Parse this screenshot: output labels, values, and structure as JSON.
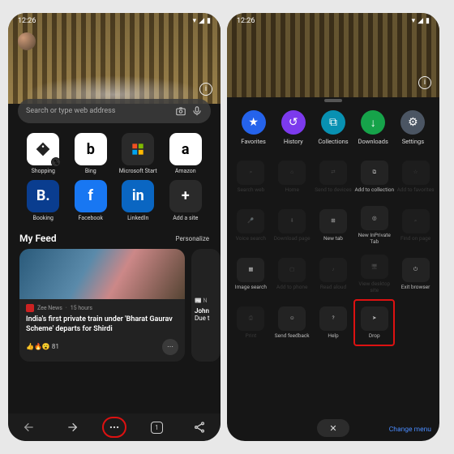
{
  "left": {
    "status": {
      "time": "12:26"
    },
    "search": {
      "placeholder": "Search or type web address"
    },
    "tiles": [
      {
        "label": "Shopping",
        "box": "white",
        "dot": true,
        "icon": "tag-icon"
      },
      {
        "label": "Bing",
        "box": "white",
        "text": "b"
      },
      {
        "label": "Microsoft Start",
        "box": "dark",
        "icon": "msstart-icon"
      },
      {
        "label": "Amazon",
        "box": "white",
        "text": "a"
      },
      {
        "label": "Booking",
        "box": "blue",
        "text": "B."
      },
      {
        "label": "Facebook",
        "box": "fb",
        "text": "f"
      },
      {
        "label": "LinkedIn",
        "box": "li",
        "text": "in"
      },
      {
        "label": "Add a site",
        "box": "dark",
        "text": "+"
      }
    ],
    "feed": {
      "title": "My Feed",
      "personalize": "Personalize",
      "card1": {
        "source": "Zee News",
        "age": "15 hours",
        "title": "India's first private train under 'Bharat Gaurav Scheme' departs for Shirdi",
        "reactions": "👍🔥😮 81"
      },
      "card2": {
        "source": "N",
        "title": "John",
        "subtitle": "Due t"
      }
    },
    "bottom": {
      "tab_count": "1"
    }
  },
  "right": {
    "status": {
      "time": "12:26"
    },
    "quick": [
      {
        "label": "Favorites",
        "cls": "q-blue",
        "icon": "star-icon"
      },
      {
        "label": "History",
        "cls": "q-purple",
        "icon": "history-icon"
      },
      {
        "label": "Collections",
        "cls": "q-teal",
        "icon": "collections-icon"
      },
      {
        "label": "Downloads",
        "cls": "q-green",
        "icon": "download-icon"
      },
      {
        "label": "Settings",
        "cls": "q-gray",
        "icon": "gear-icon"
      }
    ],
    "grid": [
      {
        "label": "Search web",
        "icon": "search-icon"
      },
      {
        "label": "Home",
        "icon": "home-icon"
      },
      {
        "label": "Send to devices",
        "icon": "devices-icon"
      },
      {
        "label": "Add to collection",
        "icon": "collections-add-icon",
        "enabled": true
      },
      {
        "label": "Add to favorites",
        "icon": "star-add-icon"
      },
      {
        "label": "Voice search",
        "icon": "mic-icon"
      },
      {
        "label": "Download page",
        "icon": "download-icon"
      },
      {
        "label": "New tab",
        "icon": "newtab-icon",
        "enabled": true
      },
      {
        "label": "New InPrivate Tab",
        "icon": "inprivate-icon",
        "enabled": true
      },
      {
        "label": "Find on page",
        "icon": "find-icon"
      },
      {
        "label": "Image search",
        "icon": "image-icon",
        "enabled": true
      },
      {
        "label": "Add to phone",
        "icon": "addphone-icon"
      },
      {
        "label": "Read aloud",
        "icon": "readaloud-icon"
      },
      {
        "label": "View desktop site",
        "icon": "desktop-icon"
      },
      {
        "label": "Exit browser",
        "icon": "exit-icon",
        "enabled": true
      },
      {
        "label": "Print",
        "icon": "print-icon"
      },
      {
        "label": "Send feedback",
        "icon": "feedback-icon",
        "enabled": true
      },
      {
        "label": "Help",
        "icon": "help-icon",
        "enabled": true
      },
      {
        "label": "Drop",
        "icon": "drop-icon",
        "enabled": true,
        "highlight": true
      },
      {
        "label": "",
        "icon": ""
      }
    ],
    "change_menu": "Change menu"
  }
}
